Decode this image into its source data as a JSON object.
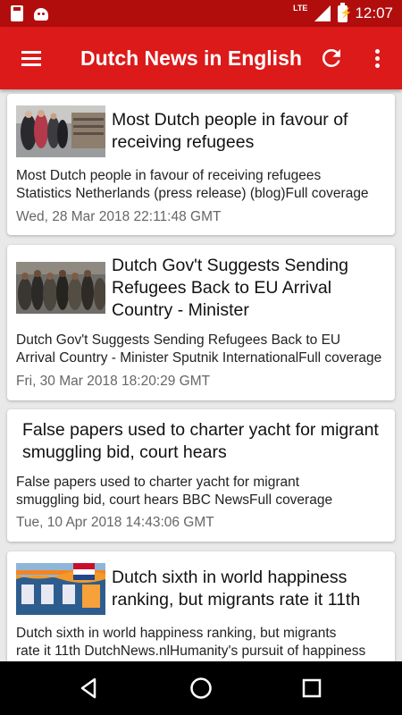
{
  "status_bar": {
    "network": "LTE",
    "time": "12:07",
    "icons": [
      "sd-card-icon",
      "android-icon",
      "signal-icon",
      "battery-charging-icon"
    ]
  },
  "app_bar": {
    "title": "Dutch News in English",
    "icons": [
      "menu-icon",
      "refresh-icon",
      "more-vert-icon"
    ]
  },
  "articles": [
    {
      "title": "Most Dutch people in favour of receiving refugees",
      "desc_lines": [
        "Most Dutch people in favour of receiving refugees",
        "Statistics Netherlands (press release) (blog)Full coverage"
      ],
      "date": "Wed, 28 Mar 2018 22:11:48 GMT",
      "has_thumb": true
    },
    {
      "title": "Dutch Gov't Suggests Sending Refugees Back to EU Arrival Country - Minister",
      "desc_lines": [
        "Dutch Gov't Suggests Sending Refugees Back to EU",
        "Arrival Country - Minister  Sputnik InternationalFull coverage"
      ],
      "date": "Fri, 30 Mar 2018 18:20:29 GMT",
      "has_thumb": true
    },
    {
      "title": "False papers used to charter yacht for migrant smuggling bid, court hears",
      "desc_lines": [
        "False papers used to charter yacht for migrant",
        "smuggling bid, court hears  BBC NewsFull coverage"
      ],
      "date": "Tue, 10 Apr 2018 14:43:06 GMT",
      "has_thumb": false
    },
    {
      "title": "Dutch sixth in world happiness ranking, but migrants rate it 11th",
      "desc_lines": [
        "Dutch sixth in world happiness ranking, but migrants",
        "rate it 11th  DutchNews.nlHumanity's pursuit of happiness"
      ],
      "date": "",
      "has_thumb": true
    }
  ],
  "nav_bar": {
    "icons": [
      "back-icon",
      "home-icon",
      "recents-icon"
    ]
  },
  "colors": {
    "status_bar": "#b20d0d",
    "app_bar": "#dc1a1a",
    "background": "#e9e9e9",
    "date_text": "#666666"
  }
}
